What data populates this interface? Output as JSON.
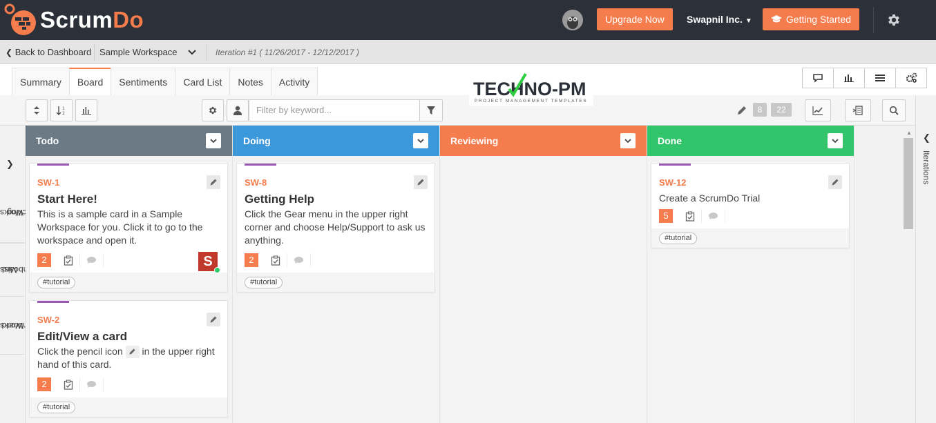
{
  "topbar": {
    "logo_main": "Scrum",
    "logo_accent": "Do",
    "upgrade_label": "Upgrade Now",
    "org_name": "Swapnil Inc.",
    "getting_started_label": "Getting Started"
  },
  "breadcrumb": {
    "back_label": "Back to Dashboard",
    "workspace": "Sample Workspace",
    "iteration": "Iteration #1 ( 11/26/2017 - 12/12/2017 )"
  },
  "tabs": [
    "Summary",
    "Board",
    "Sentiments",
    "Card List",
    "Notes",
    "Activity"
  ],
  "active_tab": "Board",
  "watermark": {
    "main": "TECHNO-PM",
    "sub": "PROJECT MANAGEMENT TEMPLATES"
  },
  "toolbar": {
    "filter_placeholder": "Filter by keyword...",
    "count_a": "8",
    "count_b": "22"
  },
  "left_nav": [
    {
      "line1": "Workspace",
      "line2": "Backlog"
    },
    {
      "line1": "Mission",
      "line2": "Dashboard"
    },
    {
      "line1": "Workspace",
      "line2": "Dashboard"
    }
  ],
  "right_nav_label": "Iterations",
  "columns": [
    {
      "name": "Todo",
      "color": "#6b7a85"
    },
    {
      "name": "Doing",
      "color": "#3a98db"
    },
    {
      "name": "Reviewing",
      "color": "#f47c4d"
    },
    {
      "name": "Done",
      "color": "#33c56b"
    }
  ],
  "cards": {
    "sw1": {
      "id": "SW-1",
      "title": "Start Here!",
      "desc": "This is a sample card in a Sample Workspace for you. Click it to go to the workspace and open it.",
      "points": "2",
      "tag": "#tutorial",
      "avatar": "S"
    },
    "sw2": {
      "id": "SW-2",
      "title": "Edit/View a card",
      "desc_a": "Click the pencil icon",
      "desc_b": "in the upper right",
      "desc_c": "hand of this card.",
      "points": "2",
      "tag": "#tutorial"
    },
    "sw8": {
      "id": "SW-8",
      "title": "Getting Help",
      "desc": "Click the Gear menu in the upper right corner and choose Help/Support to ask us anything.",
      "points": "2",
      "tag": "#tutorial"
    },
    "sw12": {
      "id": "SW-12",
      "title": "Create a ScrumDo Trial",
      "points": "5",
      "tag": "#tutorial"
    }
  },
  "colors": {
    "accent": "#f47c4d",
    "topbar": "#2c3038",
    "epic_stripe": "#9b59b6"
  }
}
